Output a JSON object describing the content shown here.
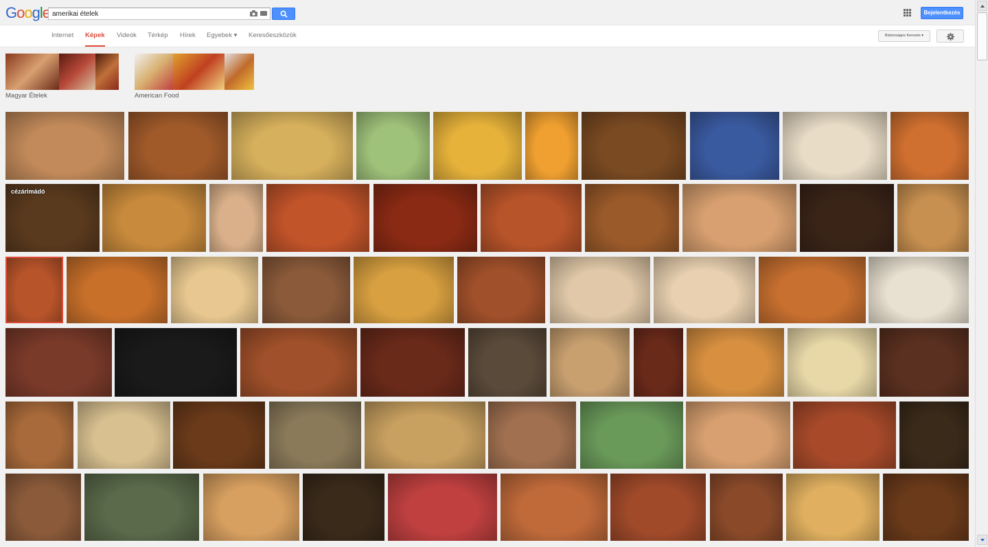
{
  "header": {
    "logo_letters": [
      {
        "ch": "G",
        "color": "#3366cc"
      },
      {
        "ch": "o",
        "color": "#dd4b39"
      },
      {
        "ch": "o",
        "color": "#eeaa00"
      },
      {
        "ch": "g",
        "color": "#3366cc"
      },
      {
        "ch": "l",
        "color": "#009925"
      },
      {
        "ch": "e",
        "color": "#dd4b39"
      }
    ],
    "search_query": "amerikai ételek",
    "signin_label": "Bejelentkezés",
    "icons": [
      "camera-icon",
      "keyboard-icon",
      "search-icon",
      "apps-grid-icon"
    ]
  },
  "nav": {
    "tabs": [
      {
        "label": "Internet",
        "active": false
      },
      {
        "label": "Képek",
        "active": true
      },
      {
        "label": "Videók",
        "active": false
      },
      {
        "label": "Térkép",
        "active": false
      },
      {
        "label": "Hírek",
        "active": false
      },
      {
        "label": "Egyebek ▾",
        "active": false
      },
      {
        "label": "Keresőeszközök",
        "active": false
      }
    ],
    "safesearch_label": "Biztonságos Keresés ▾",
    "settings_icon": "gear-icon"
  },
  "related": [
    {
      "label": "Magyar Ételek"
    },
    {
      "label": "American Food"
    }
  ],
  "overlay_text": "cézárimádó",
  "colors": {
    "accent_red": "#dd4b39",
    "button_blue": "#4d90fe",
    "results_bg": "#f1f1f1"
  },
  "image_rows": [
    [
      "#c28a5a",
      "#a05a2a",
      "#d6b05c",
      "#9fc27a",
      "#e6b23a",
      "#f0a030",
      "#7a4a22",
      "#3a5aa0",
      "#e8dcc6",
      "#d07030"
    ],
    [
      "#5a3a1e",
      "#c88a3c",
      "#d9b08a",
      "#c2542a",
      "#8a2a14",
      "#b8542a",
      "#9a5a2a",
      "#d8a070",
      "#3a2418",
      "#c89050"
    ],
    [
      "#b8542a",
      "#c8702a",
      "#e8c890",
      "#8a5a3a",
      "#d8a040",
      "#a0502a",
      "#e0c8a8",
      "#e8d0b0",
      "#c87030",
      "#e8e0d0"
    ],
    [
      "#7a3a2a",
      "#1a1a1a",
      "#a0502a",
      "#6a2a1a",
      "#5a4a3a",
      "#c8a070",
      "#6a2a1a",
      "#d89040",
      "#e8d8a8",
      "#5a3020"
    ],
    [
      "#a86a3a",
      "#d8c090",
      "#6a3a1a",
      "#8a7a5a",
      "#c8a060",
      "#a07050",
      "#6a9a5a",
      "#d8a070",
      "#a84a2a",
      "#3a2a1a"
    ],
    [
      "#8a5a3a",
      "#5a6a4a",
      "#d8a060",
      "#3a2a1a",
      "#c04040",
      "#c06a3a",
      "#a04a2a",
      "#8a4a2a",
      "#e0b060",
      "#6a3a1a"
    ]
  ]
}
